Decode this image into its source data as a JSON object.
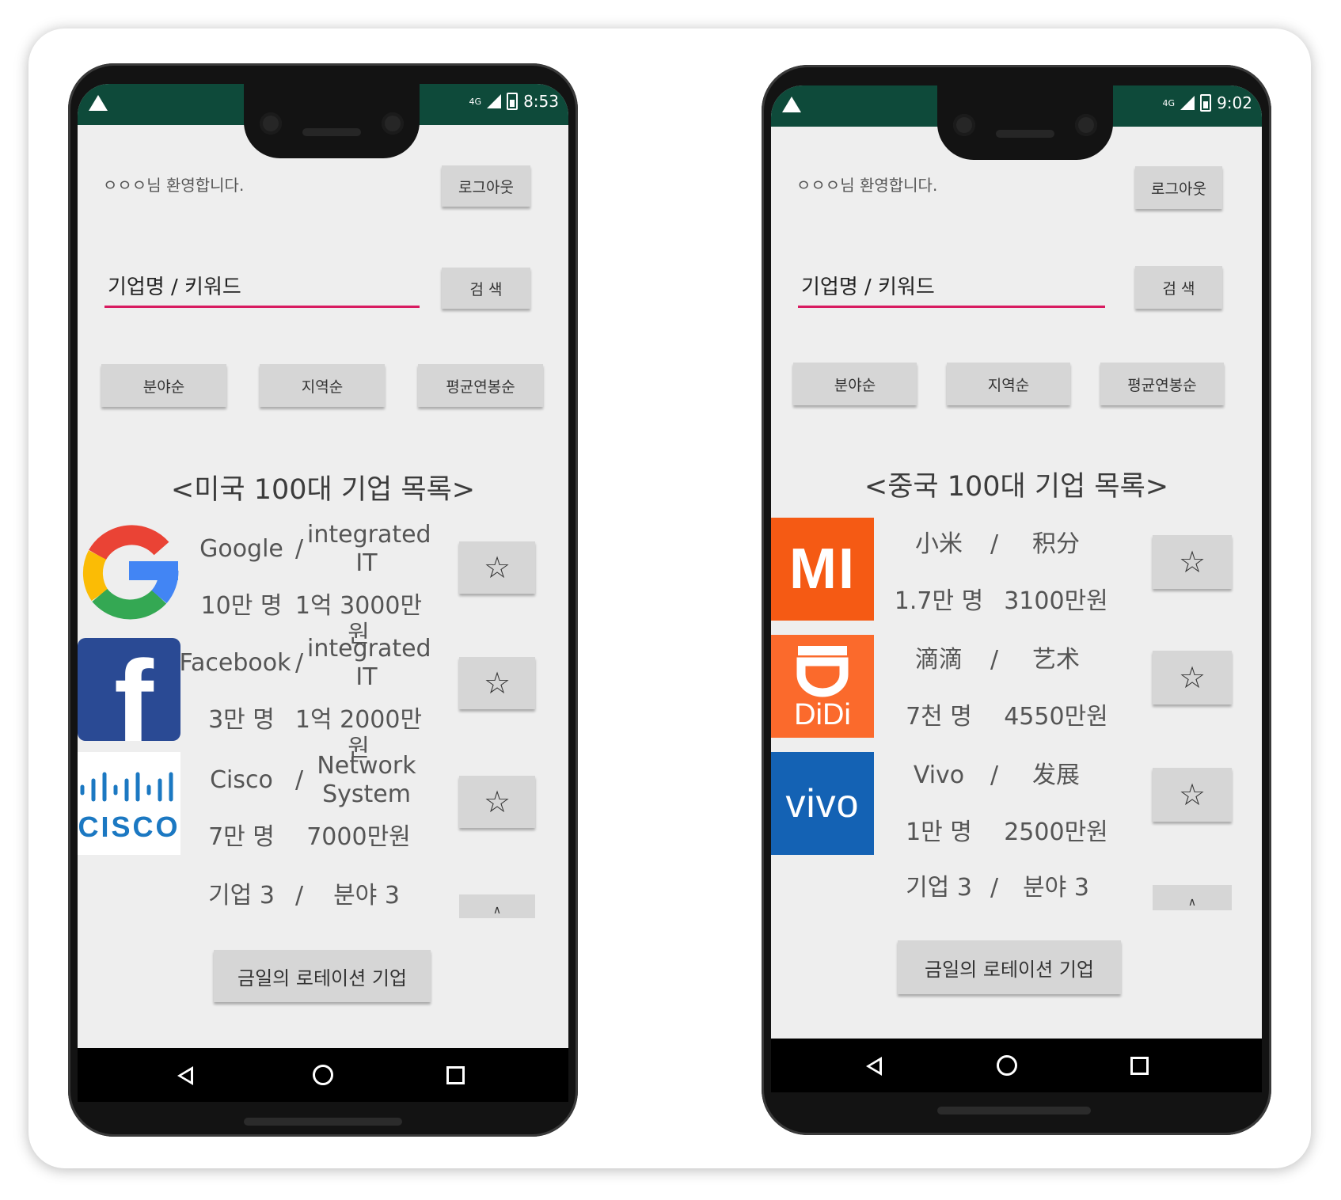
{
  "left_screen": {
    "status_time": "8:53",
    "network": "4G",
    "welcome": "ㅇㅇㅇ님 환영합니다.",
    "logout_label": "로그아웃",
    "search_placeholder": "기업명 / 키워드",
    "search_button": "검 색",
    "sort_buttons": [
      "분야순",
      "지역순",
      "평균연봉순"
    ],
    "list_title": "<미국 100대 기업 목록>",
    "companies": [
      {
        "name": "Google",
        "separator": "/",
        "field": "integrated IT",
        "employees": "10만 명",
        "salary": "1억 3000만 원",
        "logo": "google-logo",
        "star": "☆"
      },
      {
        "name": "Facebook",
        "separator": "/",
        "field": "integrated IT",
        "employees": "3만 명",
        "salary": "1억 2000만원",
        "logo": "facebook-logo",
        "logo_text": "f",
        "star": "☆"
      },
      {
        "name": "Cisco",
        "separator": "/",
        "field": "Network System",
        "employees": "7만 명",
        "salary": "7000만원",
        "logo": "cisco-logo",
        "logo_text": "CISCO",
        "star": "☆"
      }
    ],
    "last_row": {
      "name": "기업 3",
      "separator": "/",
      "field": "분야 3",
      "button": "∧"
    },
    "rotation_button": "금일의 로테이션 기업"
  },
  "right_screen": {
    "status_time": "9:02",
    "network": "4G",
    "welcome": "ㅇㅇㅇ님 환영합니다.",
    "logout_label": "로그아웃",
    "search_placeholder": "기업명 / 키워드",
    "search_button": "검 색",
    "sort_buttons": [
      "분야순",
      "지역순",
      "평균연봉순"
    ],
    "list_title": "<중국 100대 기업 목록>",
    "companies": [
      {
        "name": "小米",
        "separator": "/",
        "field": "积分",
        "employees": "1.7만 명",
        "salary": "3100만원",
        "logo": "xiaomi-logo",
        "logo_text": "MI",
        "star": "☆"
      },
      {
        "name": "滴滴",
        "separator": "/",
        "field": "艺术",
        "employees": "7천 명",
        "salary": "4550만원",
        "logo": "didi-logo",
        "logo_text": "DiDi",
        "star": "☆"
      },
      {
        "name": "Vivo",
        "separator": "/",
        "field": "发展",
        "employees": "1만 명",
        "salary": "2500만원",
        "logo": "vivo-logo",
        "logo_text": "vivo",
        "star": "☆"
      }
    ],
    "last_row": {
      "name": "기업 3",
      "separator": "/",
      "field": "분야 3",
      "button": "∧"
    },
    "rotation_button": "금일의 로테이션 기업"
  },
  "colors": {
    "status_bar": "#0e4a3a",
    "screen_bg": "#eeeeee",
    "input_underline": "#d81b60",
    "button_bg": "#d6d6d6",
    "xiaomi": "#f55a14",
    "didi": "#fb6a2c",
    "vivo": "#1462b4",
    "facebook": "#2a4a94",
    "cisco": "#1b78c2"
  }
}
